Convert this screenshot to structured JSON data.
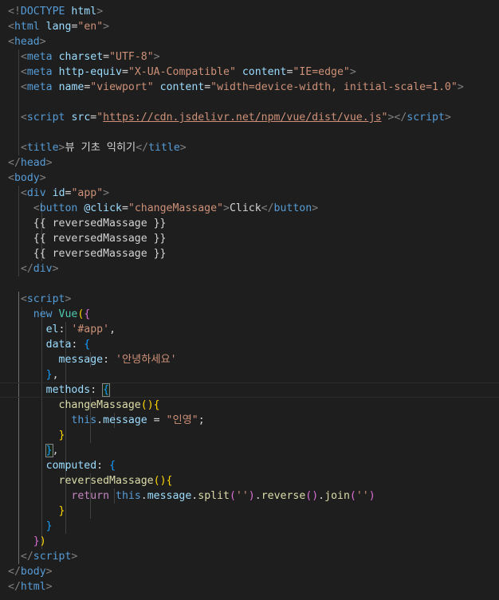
{
  "editor": {
    "language": "html",
    "lines": [
      [
        [
          "punc",
          "<!"
        ],
        [
          "tag",
          "DOCTYPE"
        ],
        [
          "text",
          " "
        ],
        [
          "attr",
          "html"
        ],
        [
          "punc",
          ">"
        ]
      ],
      [
        [
          "punc",
          "<"
        ],
        [
          "tag",
          "html"
        ],
        [
          "text",
          " "
        ],
        [
          "attr",
          "lang"
        ],
        [
          "op",
          "="
        ],
        [
          "str",
          "\"en\""
        ],
        [
          "punc",
          ">"
        ]
      ],
      [
        [
          "punc",
          "<"
        ],
        [
          "tag",
          "head"
        ],
        [
          "punc",
          ">"
        ]
      ],
      [
        [
          "text",
          "  "
        ],
        [
          "punc",
          "<"
        ],
        [
          "tag",
          "meta"
        ],
        [
          "text",
          " "
        ],
        [
          "attr",
          "charset"
        ],
        [
          "op",
          "="
        ],
        [
          "str",
          "\"UTF-8\""
        ],
        [
          "punc",
          ">"
        ]
      ],
      [
        [
          "text",
          "  "
        ],
        [
          "punc",
          "<"
        ],
        [
          "tag",
          "meta"
        ],
        [
          "text",
          " "
        ],
        [
          "attr",
          "http-equiv"
        ],
        [
          "op",
          "="
        ],
        [
          "str",
          "\"X-UA-Compatible\""
        ],
        [
          "text",
          " "
        ],
        [
          "attr",
          "content"
        ],
        [
          "op",
          "="
        ],
        [
          "str",
          "\"IE=edge\""
        ],
        [
          "punc",
          ">"
        ]
      ],
      [
        [
          "text",
          "  "
        ],
        [
          "punc",
          "<"
        ],
        [
          "tag",
          "meta"
        ],
        [
          "text",
          " "
        ],
        [
          "attr",
          "name"
        ],
        [
          "op",
          "="
        ],
        [
          "str",
          "\"viewport\""
        ],
        [
          "text",
          " "
        ],
        [
          "attr",
          "content"
        ],
        [
          "op",
          "="
        ],
        [
          "str",
          "\"width=device-width, initial-scale=1.0\""
        ],
        [
          "punc",
          ">"
        ]
      ],
      [],
      [
        [
          "text",
          "  "
        ],
        [
          "punc",
          "<"
        ],
        [
          "tag",
          "script"
        ],
        [
          "text",
          " "
        ],
        [
          "attr",
          "src"
        ],
        [
          "op",
          "="
        ],
        [
          "str",
          "\""
        ],
        [
          "url",
          "https://cdn.jsdelivr.net/npm/vue/dist/vue.js"
        ],
        [
          "str",
          "\""
        ],
        [
          "punc",
          "></"
        ],
        [
          "tag",
          "script"
        ],
        [
          "punc",
          ">"
        ]
      ],
      [],
      [
        [
          "text",
          "  "
        ],
        [
          "punc",
          "<"
        ],
        [
          "tag",
          "title"
        ],
        [
          "punc",
          ">"
        ],
        [
          "text",
          "뷰 기초 익히기"
        ],
        [
          "punc",
          "</"
        ],
        [
          "tag",
          "title"
        ],
        [
          "punc",
          ">"
        ]
      ],
      [
        [
          "punc",
          "</"
        ],
        [
          "tag",
          "head"
        ],
        [
          "punc",
          ">"
        ]
      ],
      [
        [
          "punc",
          "<"
        ],
        [
          "tag",
          "body"
        ],
        [
          "punc",
          ">"
        ]
      ],
      [
        [
          "text",
          "  "
        ],
        [
          "punc",
          "<"
        ],
        [
          "tag",
          "div"
        ],
        [
          "text",
          " "
        ],
        [
          "attr",
          "id"
        ],
        [
          "op",
          "="
        ],
        [
          "str",
          "\"app\""
        ],
        [
          "punc",
          ">"
        ]
      ],
      [
        [
          "text",
          "    "
        ],
        [
          "punc",
          "<"
        ],
        [
          "tag",
          "button"
        ],
        [
          "text",
          " "
        ],
        [
          "attr",
          "@click"
        ],
        [
          "op",
          "="
        ],
        [
          "str",
          "\"changeMassage\""
        ],
        [
          "punc",
          ">"
        ],
        [
          "text",
          "Click"
        ],
        [
          "punc",
          "</"
        ],
        [
          "tag",
          "button"
        ],
        [
          "punc",
          ">"
        ]
      ],
      [
        [
          "text",
          "    {{ reversedMassage }}"
        ]
      ],
      [
        [
          "text",
          "    {{ reversedMassage }}"
        ]
      ],
      [
        [
          "text",
          "    {{ reversedMassage }}"
        ]
      ],
      [
        [
          "text",
          "  "
        ],
        [
          "punc",
          "</"
        ],
        [
          "tag",
          "div"
        ],
        [
          "punc",
          ">"
        ]
      ],
      [],
      [
        [
          "text",
          "  "
        ],
        [
          "punc",
          "<"
        ],
        [
          "tag",
          "script"
        ],
        [
          "punc",
          ">"
        ]
      ],
      [
        [
          "text",
          "    "
        ],
        [
          "key",
          "new"
        ],
        [
          "text",
          " "
        ],
        [
          "class",
          "Vue"
        ],
        [
          "br1",
          "("
        ],
        [
          "br2",
          "{"
        ]
      ],
      [
        [
          "text",
          "      "
        ],
        [
          "prop",
          "el"
        ],
        [
          "op",
          ": "
        ],
        [
          "str",
          "'#app'"
        ],
        [
          "op",
          ","
        ]
      ],
      [
        [
          "text",
          "      "
        ],
        [
          "prop",
          "data"
        ],
        [
          "op",
          ": "
        ],
        [
          "br3",
          "{"
        ]
      ],
      [
        [
          "text",
          "        "
        ],
        [
          "prop",
          "message"
        ],
        [
          "op",
          ": "
        ],
        [
          "str",
          "'안녕하세요'"
        ]
      ],
      [
        [
          "text",
          "      "
        ],
        [
          "br3",
          "}"
        ],
        [
          "op",
          ","
        ]
      ],
      [
        [
          "text",
          "      "
        ],
        [
          "prop",
          "methods"
        ],
        [
          "op",
          ": "
        ],
        [
          "br3m",
          "{"
        ]
      ],
      [
        [
          "text",
          "        "
        ],
        [
          "fn",
          "changeMassage"
        ],
        [
          "br1",
          "()"
        ],
        [
          "br1",
          "{"
        ]
      ],
      [
        [
          "text",
          "          "
        ],
        [
          "key",
          "this"
        ],
        [
          "op",
          "."
        ],
        [
          "prop",
          "message"
        ],
        [
          "op",
          " = "
        ],
        [
          "str",
          "\"인영\""
        ],
        [
          "op",
          ";"
        ]
      ],
      [
        [
          "text",
          "        "
        ],
        [
          "br1",
          "}"
        ]
      ],
      [
        [
          "text",
          "      "
        ],
        [
          "br3m",
          "}"
        ],
        [
          "op",
          ","
        ]
      ],
      [
        [
          "text",
          "      "
        ],
        [
          "prop",
          "computed"
        ],
        [
          "op",
          ": "
        ],
        [
          "br3",
          "{"
        ]
      ],
      [
        [
          "text",
          "        "
        ],
        [
          "fn",
          "reversedMassage"
        ],
        [
          "br1",
          "()"
        ],
        [
          "br1",
          "{"
        ]
      ],
      [
        [
          "text",
          "          "
        ],
        [
          "ctrl",
          "return"
        ],
        [
          "text",
          " "
        ],
        [
          "key",
          "this"
        ],
        [
          "op",
          "."
        ],
        [
          "prop",
          "message"
        ],
        [
          "op",
          "."
        ],
        [
          "fn",
          "split"
        ],
        [
          "br2",
          "("
        ],
        [
          "str",
          "''"
        ],
        [
          "br2",
          ")"
        ],
        [
          "op",
          "."
        ],
        [
          "fn",
          "reverse"
        ],
        [
          "br2",
          "()"
        ],
        [
          "op",
          "."
        ],
        [
          "fn",
          "join"
        ],
        [
          "br2",
          "("
        ],
        [
          "str",
          "''"
        ],
        [
          "br2",
          ")"
        ]
      ],
      [
        [
          "text",
          "        "
        ],
        [
          "br1",
          "}"
        ]
      ],
      [
        [
          "text",
          "      "
        ],
        [
          "br3",
          "}"
        ]
      ],
      [
        [
          "text",
          "    "
        ],
        [
          "br2",
          "}"
        ],
        [
          "br1",
          ")"
        ]
      ],
      [
        [
          "text",
          "  "
        ],
        [
          "punc",
          "</"
        ],
        [
          "tag",
          "script"
        ],
        [
          "punc",
          ">"
        ]
      ],
      [
        [
          "punc",
          "</"
        ],
        [
          "tag",
          "body"
        ],
        [
          "punc",
          ">"
        ]
      ],
      [
        [
          "punc",
          "</"
        ],
        [
          "tag",
          "html"
        ],
        [
          "punc",
          ">"
        ]
      ]
    ],
    "current_line": 25
  }
}
